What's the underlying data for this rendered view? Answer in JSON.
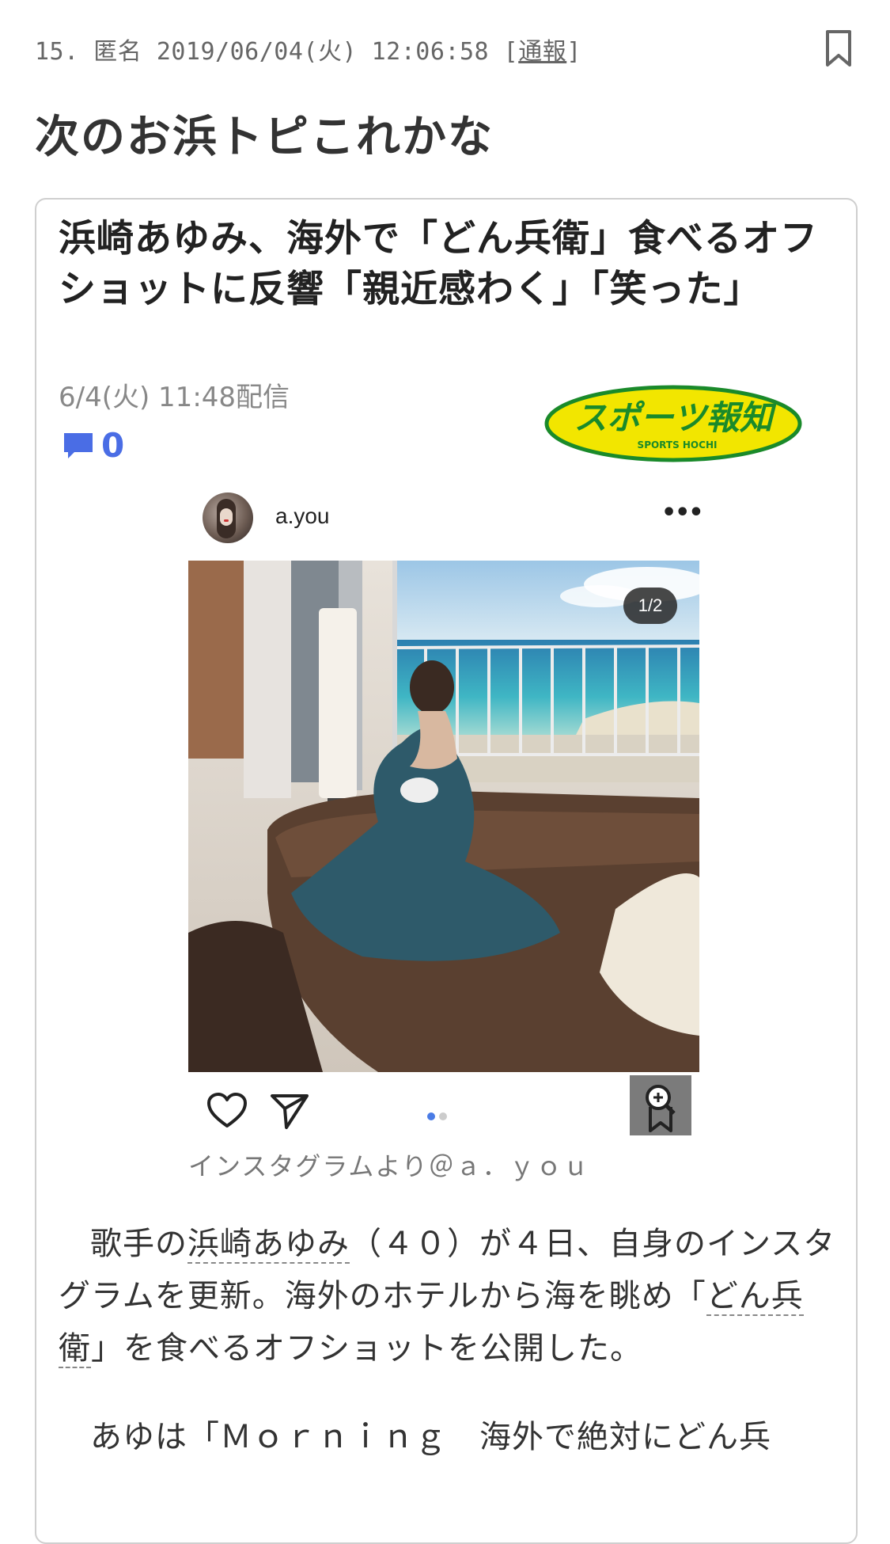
{
  "comment": {
    "number": "15.",
    "author": "匿名",
    "datetime": "2019/06/04(火) 12:06:58",
    "report_open": "[",
    "report_label": "通報",
    "report_close": "]",
    "text": "次のお浜トピこれかな"
  },
  "article": {
    "headline": "浜崎あゆみ、海外で「どん兵衛」食べるオフショットに反響「親近感わく」「笑った」",
    "published": "6/4(火) 11:48配信",
    "comment_count": "0",
    "source_logo": {
      "main_text": "スポーツ報知",
      "sub_text": "SPORTS HOCHI",
      "color_bg": "#f2e600",
      "color_border": "#1a8a2a",
      "color_text": "#1a8a2a"
    },
    "embed": {
      "username": "a.you",
      "more": "•••",
      "counter": "1/2",
      "carousel_dots": [
        {
          "active": true,
          "color": "#4a7be5"
        },
        {
          "active": false,
          "color": "#cccccc"
        }
      ],
      "caption": "インスタグラムより＠ａ．ｙｏｕ"
    },
    "body": {
      "p1_pre": "歌手の",
      "p1_link1": "浜崎あゆみ",
      "p1_mid": "（４０）が４日、自身のインスタグラムを更新。海外のホテルから海を眺め「",
      "p1_link2": "どん兵衛",
      "p1_post": "」を食べるオフショットを公開した。",
      "p2": "あゆは「Ｍｏｒｎｉｎｇ　海外で絶対にどん兵"
    }
  },
  "colors": {
    "accent": "#4a6de5",
    "meta_text": "#666666"
  }
}
